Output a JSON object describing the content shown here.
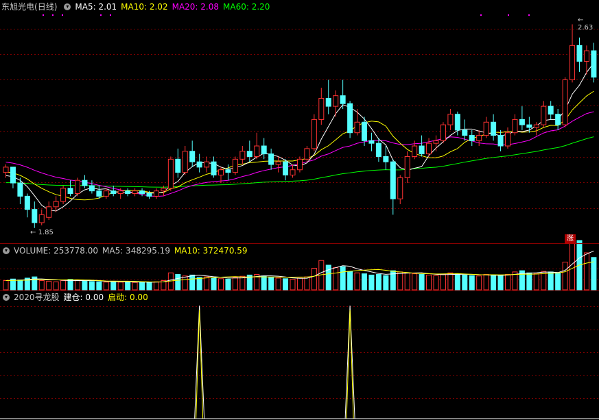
{
  "header": {
    "stock_name": "东旭光电",
    "period": "(日线)",
    "ma5_label": "MA5: 2.01",
    "ma10_label": "MA10: 2.02",
    "ma20_label": "MA20: 2.08",
    "ma60_label": "MA60: 2.20"
  },
  "volume_header": {
    "volume_label": "VOLUME: 253778.00",
    "ma5_label": "MA5: 348295.19",
    "ma10_label": "MA10: 372470.59"
  },
  "indicator_header": {
    "name": "2020寻龙股",
    "jiancang_label": "建仓: 0.00",
    "qidong_label": "启动: 0.00"
  },
  "markers": {
    "high_price": "2.63",
    "low_price": "1.85",
    "zhang_badge": "涨"
  },
  "colors": {
    "background": "#000000",
    "up": "#ff3232",
    "down": "#54ffff",
    "ma5": "#ffffff",
    "ma10": "#ffff00",
    "ma20": "#ff00ff",
    "ma60": "#00ff00",
    "grid": "#7a0000",
    "indicator_line_1": "#ffffff",
    "indicator_line_2": "#ffff00"
  },
  "chart_data": {
    "type": "candlestick",
    "price_axis": {
      "min": 1.8,
      "max": 2.66
    },
    "candles": [
      [
        2.06,
        2.09,
        2.04,
        2.08
      ],
      [
        2.08,
        2.08,
        2.0,
        2.02
      ],
      [
        2.02,
        2.04,
        1.94,
        1.97
      ],
      [
        1.97,
        1.98,
        1.89,
        1.92
      ],
      [
        1.92,
        1.95,
        1.85,
        1.87
      ],
      [
        1.87,
        1.92,
        1.86,
        1.9
      ],
      [
        1.89,
        1.95,
        1.88,
        1.93
      ],
      [
        1.93,
        1.97,
        1.91,
        1.95
      ],
      [
        1.95,
        2.01,
        1.94,
        2.0
      ],
      [
        2.0,
        2.03,
        1.97,
        1.98
      ],
      [
        1.98,
        2.04,
        1.97,
        2.03
      ],
      [
        2.03,
        2.05,
        2.0,
        2.01
      ],
      [
        2.01,
        2.03,
        1.98,
        1.99
      ],
      [
        1.99,
        2.01,
        1.96,
        1.97
      ],
      [
        1.97,
        2.0,
        1.96,
        1.99
      ],
      [
        1.99,
        2.01,
        1.97,
        1.98
      ],
      [
        1.98,
        2.0,
        1.96,
        1.99
      ],
      [
        1.99,
        2.0,
        1.97,
        1.98
      ],
      [
        1.98,
        2.0,
        1.97,
        1.99
      ],
      [
        1.99,
        2.0,
        1.97,
        1.98
      ],
      [
        1.98,
        1.99,
        1.96,
        1.97
      ],
      [
        1.97,
        2.0,
        1.96,
        1.99
      ],
      [
        1.99,
        2.01,
        1.97,
        2.0
      ],
      [
        2.0,
        2.12,
        1.99,
        2.11
      ],
      [
        2.11,
        2.15,
        2.04,
        2.06
      ],
      [
        2.06,
        2.16,
        2.05,
        2.14
      ],
      [
        2.14,
        2.18,
        2.08,
        2.1
      ],
      [
        2.1,
        2.13,
        2.06,
        2.08
      ],
      [
        2.08,
        2.12,
        2.06,
        2.1
      ],
      [
        2.1,
        2.12,
        2.04,
        2.05
      ],
      [
        2.05,
        2.08,
        2.02,
        2.07
      ],
      [
        2.07,
        2.09,
        2.03,
        2.06
      ],
      [
        2.06,
        2.12,
        2.05,
        2.11
      ],
      [
        2.11,
        2.16,
        2.09,
        2.14
      ],
      [
        2.14,
        2.18,
        2.1,
        2.12
      ],
      [
        2.12,
        2.21,
        2.11,
        2.16
      ],
      [
        2.16,
        2.19,
        2.11,
        2.13
      ],
      [
        2.13,
        2.15,
        2.07,
        2.09
      ],
      [
        2.09,
        2.12,
        2.06,
        2.1
      ],
      [
        2.1,
        2.11,
        2.03,
        2.05
      ],
      [
        2.05,
        2.09,
        2.04,
        2.07
      ],
      [
        2.07,
        2.12,
        2.06,
        2.11
      ],
      [
        2.11,
        2.16,
        2.1,
        2.15
      ],
      [
        2.15,
        2.28,
        2.14,
        2.26
      ],
      [
        2.26,
        2.38,
        2.24,
        2.34
      ],
      [
        2.34,
        2.41,
        2.28,
        2.31
      ],
      [
        2.31,
        2.37,
        2.27,
        2.35
      ],
      [
        2.35,
        2.41,
        2.3,
        2.32
      ],
      [
        2.32,
        2.33,
        2.19,
        2.21
      ],
      [
        2.21,
        2.3,
        2.2,
        2.25
      ],
      [
        2.25,
        2.27,
        2.16,
        2.18
      ],
      [
        2.18,
        2.21,
        2.14,
        2.17
      ],
      [
        2.17,
        2.19,
        2.1,
        2.12
      ],
      [
        2.12,
        2.16,
        2.07,
        2.1
      ],
      [
        2.1,
        2.11,
        1.9,
        1.96
      ],
      [
        1.96,
        2.05,
        1.94,
        2.04
      ],
      [
        2.04,
        2.14,
        2.02,
        2.12
      ],
      [
        2.12,
        2.18,
        2.11,
        2.16
      ],
      [
        2.16,
        2.2,
        2.12,
        2.13
      ],
      [
        2.13,
        2.19,
        2.12,
        2.17
      ],
      [
        2.17,
        2.2,
        2.14,
        2.18
      ],
      [
        2.18,
        2.25,
        2.17,
        2.24
      ],
      [
        2.24,
        2.3,
        2.22,
        2.28
      ],
      [
        2.28,
        2.29,
        2.2,
        2.22
      ],
      [
        2.22,
        2.26,
        2.18,
        2.2
      ],
      [
        2.2,
        2.22,
        2.16,
        2.18
      ],
      [
        2.18,
        2.22,
        2.16,
        2.2
      ],
      [
        2.2,
        2.27,
        2.19,
        2.25
      ],
      [
        2.25,
        2.28,
        2.18,
        2.2
      ],
      [
        2.2,
        2.22,
        2.14,
        2.16
      ],
      [
        2.16,
        2.23,
        2.15,
        2.21
      ],
      [
        2.21,
        2.28,
        2.2,
        2.26
      ],
      [
        2.26,
        2.31,
        2.22,
        2.24
      ],
      [
        2.24,
        2.27,
        2.21,
        2.23
      ],
      [
        2.23,
        2.25,
        2.2,
        2.24
      ],
      [
        2.24,
        2.33,
        2.23,
        2.31
      ],
      [
        2.31,
        2.33,
        2.26,
        2.28
      ],
      [
        2.28,
        2.3,
        2.22,
        2.24
      ],
      [
        2.24,
        2.42,
        2.23,
        2.41
      ],
      [
        2.41,
        2.62,
        2.4,
        2.54
      ],
      [
        2.54,
        2.57,
        2.44,
        2.48
      ],
      [
        2.48,
        2.54,
        2.43,
        2.52
      ],
      [
        2.52,
        2.55,
        2.4,
        2.42
      ]
    ],
    "volume": [
      0.3,
      0.35,
      0.32,
      0.38,
      0.42,
      0.3,
      0.28,
      0.26,
      0.3,
      0.34,
      0.32,
      0.28,
      0.27,
      0.26,
      0.25,
      0.27,
      0.25,
      0.26,
      0.24,
      0.25,
      0.24,
      0.26,
      0.3,
      0.55,
      0.5,
      0.45,
      0.48,
      0.4,
      0.42,
      0.38,
      0.36,
      0.35,
      0.4,
      0.44,
      0.48,
      0.5,
      0.45,
      0.4,
      0.38,
      0.36,
      0.34,
      0.38,
      0.42,
      0.7,
      0.95,
      0.8,
      0.72,
      0.75,
      0.6,
      0.55,
      0.52,
      0.48,
      0.5,
      0.46,
      0.62,
      0.58,
      0.55,
      0.52,
      0.5,
      0.48,
      0.46,
      0.5,
      0.55,
      0.52,
      0.48,
      0.46,
      0.45,
      0.5,
      0.48,
      0.46,
      0.5,
      0.58,
      0.62,
      0.55,
      0.52,
      0.6,
      0.58,
      0.55,
      0.9,
      1.55,
      1.6,
      1.2,
      1.05
    ],
    "indicator_spike_positions": [
      27,
      48
    ]
  }
}
